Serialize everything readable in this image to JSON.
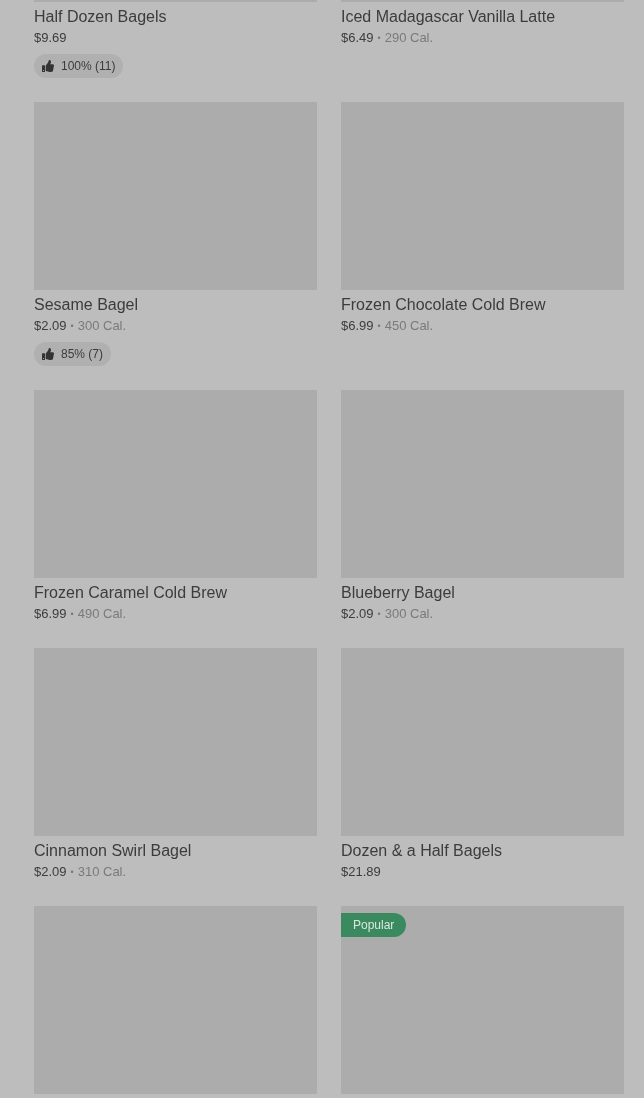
{
  "separator": "•",
  "items": [
    {
      "kind": "card",
      "name": "Half Dozen Bagels",
      "price": "$9.69",
      "rating": "100% (11)"
    },
    {
      "kind": "card",
      "name": "Iced Madagascar Vanilla Latte",
      "price": "$6.49",
      "calories": "290 Cal."
    },
    {
      "kind": "card",
      "name": "Sesame Bagel",
      "price": "$2.09",
      "calories": "300 Cal.",
      "rating": "85% (7)"
    },
    {
      "kind": "card",
      "name": "Frozen Chocolate Cold Brew",
      "price": "$6.99",
      "calories": "450 Cal."
    },
    {
      "kind": "card",
      "name": "Frozen Caramel Cold Brew",
      "price": "$6.99",
      "calories": "490 Cal."
    },
    {
      "kind": "card",
      "name": "Blueberry Bagel",
      "price": "$2.09",
      "calories": "300 Cal."
    },
    {
      "kind": "card",
      "name": "Cinnamon Swirl Bagel",
      "price": "$2.09",
      "calories": "310 Cal."
    },
    {
      "kind": "card",
      "name": "Dozen & a Half Bagels",
      "price": "$21.89"
    },
    {
      "kind": "card"
    },
    {
      "kind": "card",
      "badge": "Popular"
    }
  ]
}
